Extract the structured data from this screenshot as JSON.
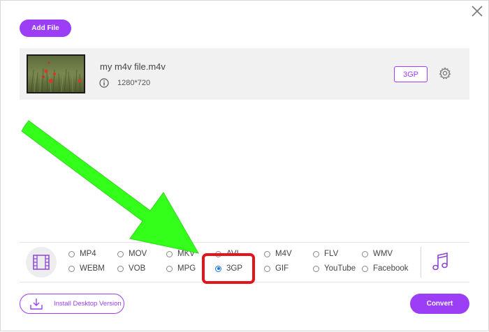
{
  "toolbar": {
    "add_file_label": "Add File"
  },
  "file": {
    "name": "my m4v file.m4v",
    "resolution": "1280*720",
    "output_format": "3GP"
  },
  "formats": {
    "video_options": [
      {
        "label": "MP4",
        "checked": false
      },
      {
        "label": "MOV",
        "checked": false
      },
      {
        "label": "MKV",
        "checked": false
      },
      {
        "label": "AVI",
        "checked": false
      },
      {
        "label": "M4V",
        "checked": false
      },
      {
        "label": "FLV",
        "checked": false
      },
      {
        "label": "WMV",
        "checked": false
      },
      {
        "label": "WEBM",
        "checked": false
      },
      {
        "label": "VOB",
        "checked": false
      },
      {
        "label": "MPG",
        "checked": false
      },
      {
        "label": "3GP",
        "checked": true
      },
      {
        "label": "GIF",
        "checked": false
      },
      {
        "label": "YouTube",
        "checked": false
      },
      {
        "label": "Facebook",
        "checked": false
      }
    ],
    "selected": "3GP"
  },
  "footer": {
    "install_label": "Install Desktop Version",
    "convert_label": "Convert"
  },
  "icons": {
    "close": "close-icon",
    "info": "info-icon",
    "settings": "gear-icon",
    "video_tab": "film-icon",
    "audio_tab": "music-note-icon",
    "install": "download-icon"
  },
  "colors": {
    "accent": "#9b3ef5",
    "highlight": "#e5141b",
    "arrow": "#33ff1a",
    "radio_selected": "#1a73e8"
  }
}
